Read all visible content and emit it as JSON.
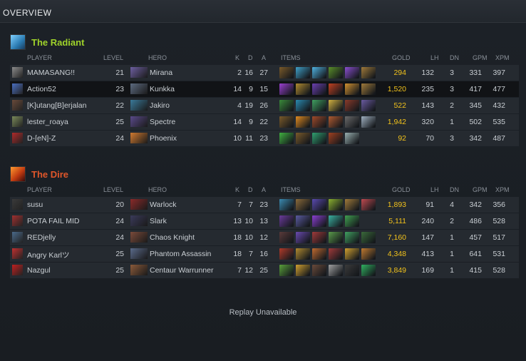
{
  "header": {
    "title": "OVERVIEW"
  },
  "columns": {
    "player": "PLAYER",
    "level": "LEVEL",
    "hero": "HERO",
    "k": "K",
    "d": "D",
    "a": "A",
    "items": "ITEMS",
    "gold": "GOLD",
    "lh": "LH",
    "dn": "DN",
    "gpm": "GPM",
    "xpm": "XPM"
  },
  "radiant": {
    "name": "The Radiant",
    "color": "#9fd22b",
    "players": [
      {
        "player": "MAMASANG!!",
        "level": "21",
        "hero": "Mirana",
        "k": "2",
        "d": "16",
        "a": "27",
        "gold": "294",
        "lh": "132",
        "dn": "3",
        "gpm": "331",
        "xpm": "397",
        "avatar": "#8c8c8c",
        "hero_color": "#6d5fa0",
        "items": [
          "#7a5a2a",
          "#3fa0c8",
          "#4fb2e0",
          "#5a8f2a",
          "#8a4fd0",
          "#a07a3a"
        ]
      },
      {
        "player": "Action52",
        "level": "23",
        "hero": "Kunkka",
        "k": "14",
        "d": "9",
        "a": "15",
        "gold": "1,520",
        "lh": "235",
        "dn": "3",
        "gpm": "417",
        "xpm": "477",
        "avatar": "#4a6fc0",
        "hero_color": "#5c6a80",
        "items": [
          "#9a3fd0",
          "#b08a30",
          "#6a3fb0",
          "#c04020",
          "#d09030",
          "#a07a3a"
        ]
      },
      {
        "player": "[K]utang[B]erjalan",
        "level": "22",
        "hero": "Jakiro",
        "k": "4",
        "d": "19",
        "a": "26",
        "gold": "522",
        "lh": "143",
        "dn": "2",
        "gpm": "345",
        "xpm": "432",
        "avatar": "#6a4a3a",
        "hero_color": "#3a7a9a",
        "items": [
          "#3a8a3a",
          "#2a8ab0",
          "#40a060",
          "#d0b040",
          "#8a3a2a",
          "#6a5aa0"
        ]
      },
      {
        "player": "lester_roaya",
        "level": "25",
        "hero": "Spectre",
        "k": "14",
        "d": "9",
        "a": "22",
        "gold": "1,942",
        "lh": "320",
        "dn": "1",
        "gpm": "502",
        "xpm": "535",
        "avatar": "#7a8a5a",
        "hero_color": "#5a4a8a",
        "items": [
          "#7a5a2a",
          "#e08a20",
          "#a04a2a",
          "#b05a30",
          "#6a6a6a",
          "#a0b0c0"
        ]
      },
      {
        "player": "D-[eN]-Z",
        "level": "24",
        "hero": "Phoenix",
        "k": "10",
        "d": "11",
        "a": "23",
        "gold": "92",
        "lh": "70",
        "dn": "3",
        "gpm": "342",
        "xpm": "487",
        "avatar": "#b02a2a",
        "hero_color": "#d07a30",
        "items": [
          "#40b040",
          "#7a5a2a",
          "#30a070",
          "#a04020",
          "#9ab0b0"
        ]
      }
    ]
  },
  "dire": {
    "name": "The Dire",
    "color": "#e0562a",
    "players": [
      {
        "player": "susu",
        "level": "20",
        "hero": "Warlock",
        "k": "7",
        "d": "7",
        "a": "23",
        "gold": "1,893",
        "lh": "91",
        "dn": "4",
        "gpm": "342",
        "xpm": "356",
        "avatar": "#3a3a3a",
        "hero_color": "#8a2a2a",
        "items": [
          "#3a8ab0",
          "#8a6a3a",
          "#5a4ab0",
          "#8ab030",
          "#a07a3a",
          "#c04a50"
        ]
      },
      {
        "player": "POTA FAIL MID",
        "level": "24",
        "hero": "Slark",
        "k": "13",
        "d": "10",
        "a": "13",
        "gold": "5,111",
        "lh": "240",
        "dn": "2",
        "gpm": "486",
        "xpm": "528",
        "avatar": "#a03030",
        "hero_color": "#3a3a5a",
        "items": [
          "#6a3a9a",
          "#5a5aa0",
          "#8a3fd0",
          "#3ab0a0",
          "#40a050"
        ]
      },
      {
        "player": "REDjelly",
        "level": "24",
        "hero": "Chaos Knight",
        "k": "18",
        "d": "10",
        "a": "12",
        "gold": "7,160",
        "lh": "147",
        "dn": "1",
        "gpm": "457",
        "xpm": "517",
        "avatar": "#4a6a8a",
        "hero_color": "#7a4a3a",
        "items": [
          "#5a3a3a",
          "#6a4ab0",
          "#a03a3a",
          "#5a9a4a",
          "#40a060",
          "#3a6a3a"
        ]
      },
      {
        "player": "Angry Karlツ",
        "level": "25",
        "hero": "Phantom Assassin",
        "k": "18",
        "d": "7",
        "a": "16",
        "gold": "4,348",
        "lh": "413",
        "dn": "1",
        "gpm": "641",
        "xpm": "531",
        "avatar": "#c03030",
        "hero_color": "#5a6a8a",
        "items": [
          "#b03a2a",
          "#b08a30",
          "#c06a30",
          "#a03a3a",
          "#d0a030",
          "#c07a30"
        ]
      },
      {
        "player": "Nazgul",
        "level": "25",
        "hero": "Centaur Warrunner",
        "k": "7",
        "d": "12",
        "a": "25",
        "gold": "3,849",
        "lh": "169",
        "dn": "1",
        "gpm": "415",
        "xpm": "528",
        "avatar": "#c02020",
        "hero_color": "#8a5a3a",
        "items": [
          "#5aa03a",
          "#d0a030",
          "#6a4a3a",
          "#a0a0a0",
          "#3a3a3a",
          "#30b060"
        ]
      }
    ]
  },
  "footer": {
    "replay": "Replay Unavailable"
  }
}
